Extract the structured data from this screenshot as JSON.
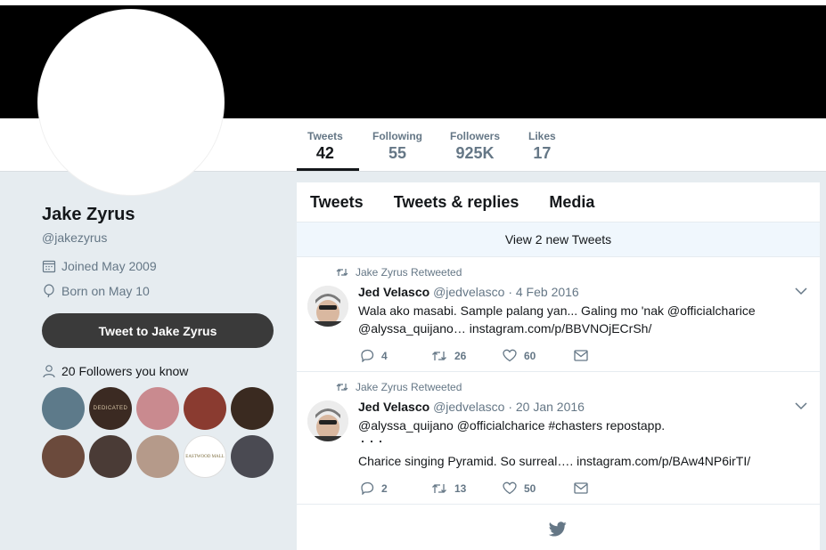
{
  "profile": {
    "name": "Jake Zyrus",
    "handle": "@jakezyrus",
    "joined": "Joined May 2009",
    "born": "Born on May 10",
    "tweet_to_label": "Tweet to Jake Zyrus",
    "followers_you_know": "20 Followers you know"
  },
  "stats": [
    {
      "label": "Tweets",
      "value": "42"
    },
    {
      "label": "Following",
      "value": "55"
    },
    {
      "label": "Followers",
      "value": "925K"
    },
    {
      "label": "Likes",
      "value": "17"
    }
  ],
  "timeline": {
    "tabs": [
      "Tweets",
      "Tweets & replies",
      "Media"
    ],
    "new_tweets": "View 2 new Tweets",
    "tweets": [
      {
        "retweeted_by": "Jake Zyrus Retweeted",
        "author": "Jed Velasco",
        "handle": "@jedvelasco",
        "date": "· 4 Feb 2016",
        "line1": "Wala ako masabi. Sample palang yan... Galing mo 'nak @officialcharice",
        "line2": "@alyssa_quijano… instagram.com/p/BBVNOjECrSh/",
        "line3": "",
        "replies": "4",
        "retweets": "26",
        "likes": "60"
      },
      {
        "retweeted_by": "Jake Zyrus Retweeted",
        "author": "Jed Velasco",
        "handle": "@jedvelasco",
        "date": "· 20 Jan 2016",
        "line1": "@alyssa_quijano  @officialcharice #chasters repostapp.",
        "line2": "・・・",
        "line3": "Charice singing Pyramid. So surreal…. instagram.com/p/BAw4NP6irTI/",
        "replies": "2",
        "retweets": "13",
        "likes": "50"
      }
    ]
  },
  "followers_grid": {
    "colors": [
      "#5d7a8a",
      "#3b2a22",
      "#c98a8f",
      "#8a3b30",
      "#3a2a20",
      "#6b4a3c",
      "#4a3b36",
      "#b59a8a",
      "#ffffff",
      "#4a4a52"
    ],
    "tile_text": [
      "",
      "DEDICATED",
      "",
      "",
      "",
      "",
      "",
      "",
      "EASTWOOD MALL",
      ""
    ]
  },
  "colors": {
    "accent": "#1da1f2",
    "text_primary": "#14171a",
    "text_secondary": "#657786",
    "page_bg": "#e6ecf0",
    "banner": "#000000",
    "button_dark": "#3a3a3a"
  }
}
